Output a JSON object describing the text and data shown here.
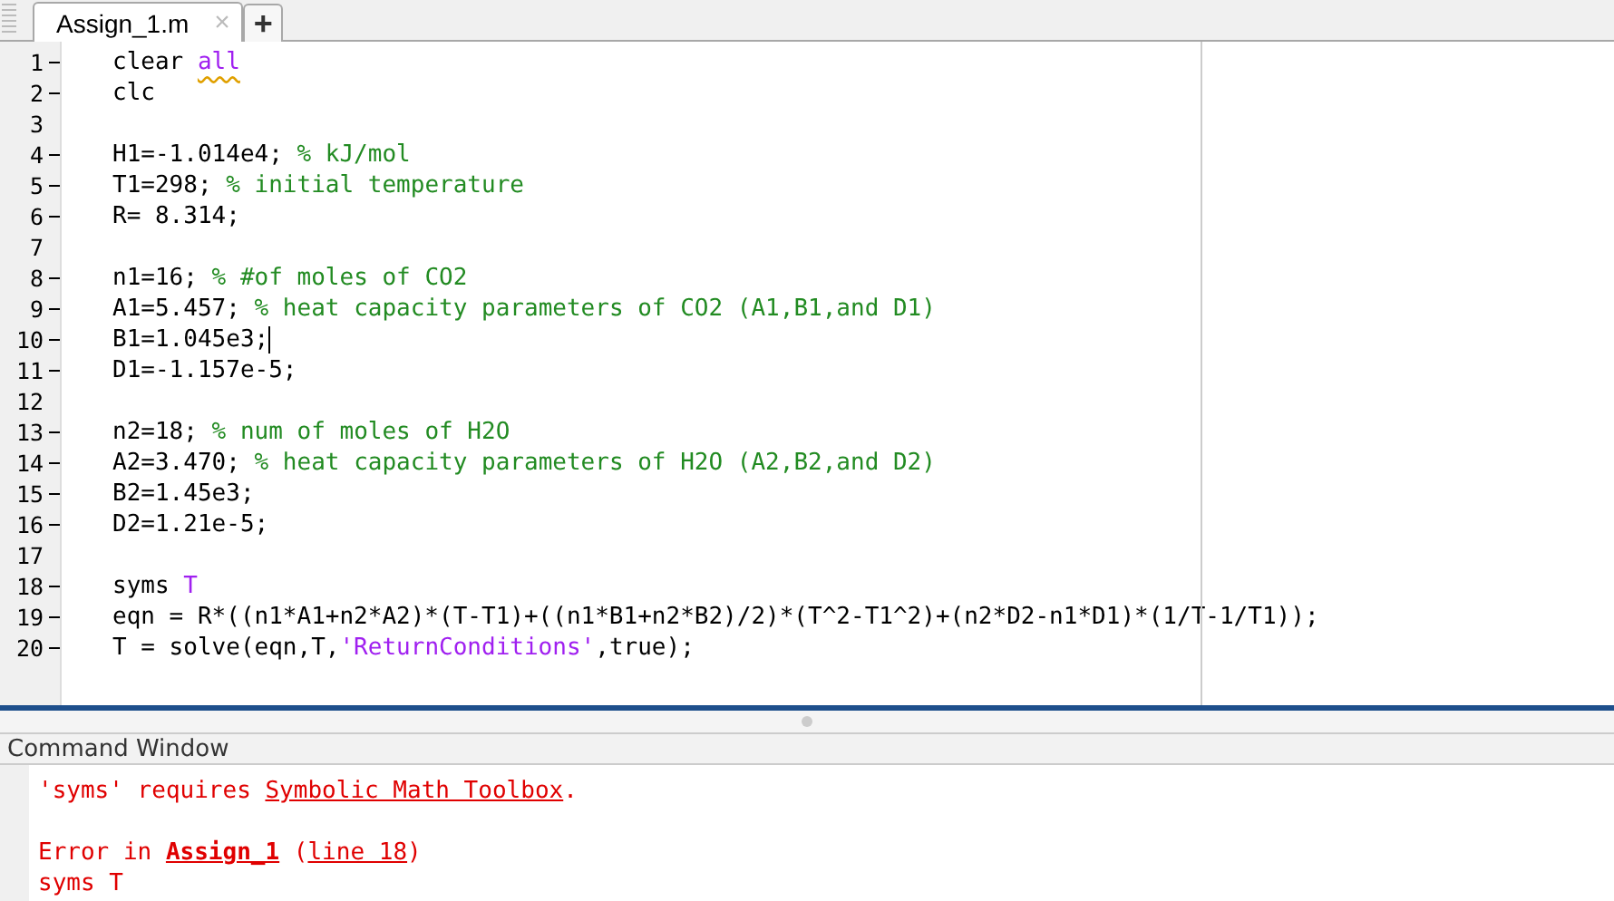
{
  "editor": {
    "tabs": [
      {
        "label": "Assign_1.m",
        "close": "×",
        "selected": true
      },
      {
        "label": "+",
        "kind": "new",
        "selected": false
      }
    ],
    "lines": [
      {
        "number": "1",
        "executable": true,
        "cursor": false,
        "segments": [
          {
            "kind": "code",
            "text": "clear "
          },
          {
            "kind": "flagged",
            "text": "all"
          }
        ]
      },
      {
        "number": "2",
        "executable": true,
        "cursor": false,
        "segments": [
          {
            "kind": "code",
            "text": "clc"
          }
        ]
      },
      {
        "number": "3",
        "executable": false,
        "cursor": false
      },
      {
        "number": "4",
        "executable": true,
        "cursor": false,
        "segments": [
          {
            "kind": "code",
            "text": "H1=-1.014e4; "
          },
          {
            "kind": "comment",
            "text": "% kJ/mol"
          }
        ]
      },
      {
        "number": "5",
        "executable": true,
        "cursor": false,
        "segments": [
          {
            "kind": "code",
            "text": "T1=298; "
          },
          {
            "kind": "comment",
            "text": "% initial temperature"
          }
        ]
      },
      {
        "number": "6",
        "executable": true,
        "cursor": false,
        "segments": [
          {
            "kind": "code",
            "text": "R= 8.314;"
          }
        ]
      },
      {
        "number": "7",
        "executable": false,
        "cursor": false
      },
      {
        "number": "8",
        "executable": true,
        "cursor": false,
        "segments": [
          {
            "kind": "code",
            "text": "n1=16; "
          },
          {
            "kind": "comment",
            "text": "% #of moles of CO2"
          }
        ]
      },
      {
        "number": "9",
        "executable": true,
        "cursor": false,
        "segments": [
          {
            "kind": "code",
            "text": "A1=5.457; "
          },
          {
            "kind": "comment",
            "text": "% heat capacity parameters of CO2 (A1,B1,and D1)"
          }
        ]
      },
      {
        "number": "10",
        "executable": true,
        "cursor": true,
        "segments": [
          {
            "kind": "code",
            "text": "B1=1.045e3;"
          }
        ]
      },
      {
        "number": "11",
        "executable": true,
        "cursor": false,
        "segments": [
          {
            "kind": "code",
            "text": "D1=-1.157e-5;"
          }
        ]
      },
      {
        "number": "12",
        "executable": false,
        "cursor": false
      },
      {
        "number": "13",
        "executable": true,
        "cursor": false,
        "segments": [
          {
            "kind": "code",
            "text": "n2=18; "
          },
          {
            "kind": "comment",
            "text": "% num of moles of H2O"
          }
        ]
      },
      {
        "number": "14",
        "executable": true,
        "cursor": false,
        "segments": [
          {
            "kind": "code",
            "text": "A2=3.470; "
          },
          {
            "kind": "comment",
            "text": "% heat capacity parameters of H2O (A2,B2,and D2)"
          }
        ]
      },
      {
        "number": "15",
        "executable": true,
        "cursor": false,
        "segments": [
          {
            "kind": "code",
            "text": "B2=1.45e3;"
          }
        ]
      },
      {
        "number": "16",
        "executable": true,
        "cursor": false,
        "segments": [
          {
            "kind": "code",
            "text": "D2=1.21e-5;"
          }
        ]
      },
      {
        "number": "17",
        "executable": false,
        "cursor": false
      },
      {
        "number": "18",
        "executable": true,
        "cursor": false,
        "segments": [
          {
            "kind": "code",
            "text": "syms "
          },
          {
            "kind": "string",
            "text": "T"
          }
        ]
      },
      {
        "number": "19",
        "executable": true,
        "cursor": false,
        "segments": [
          {
            "kind": "code",
            "text": "eqn = R*((n1*A1+n2*A2)*(T-T1)+((n1*B1+n2*B2)/2)*(T^2-T1^2)+(n2*D2-n1*D1)*(1/T-1/T1));"
          }
        ]
      },
      {
        "number": "20",
        "executable": true,
        "cursor": false,
        "segments": [
          {
            "kind": "code",
            "text": "T = solve(eqn,T,"
          },
          {
            "kind": "string",
            "text": "'ReturnConditions'"
          },
          {
            "kind": "code",
            "text": ",true);"
          }
        ]
      }
    ]
  },
  "command_window": {
    "title": "Command Window",
    "lines": [
      {
        "kind": "message",
        "segments": [
          {
            "kind": "error",
            "text": "'syms' requires "
          },
          {
            "kind": "link",
            "text": "Symbolic Math Toolbox"
          },
          {
            "kind": "error",
            "text": "."
          }
        ]
      },
      {
        "kind": "blank"
      },
      {
        "kind": "message",
        "segments": [
          {
            "kind": "error",
            "text": "Error in "
          },
          {
            "kind": "bold_link",
            "text": "Assign_1"
          },
          {
            "kind": "error",
            "text": " ("
          },
          {
            "kind": "link",
            "text": "line 18"
          },
          {
            "kind": "error",
            "text": ")"
          }
        ]
      },
      {
        "kind": "message",
        "segments": [
          {
            "kind": "error",
            "text": "syms T"
          }
        ]
      }
    ]
  }
}
